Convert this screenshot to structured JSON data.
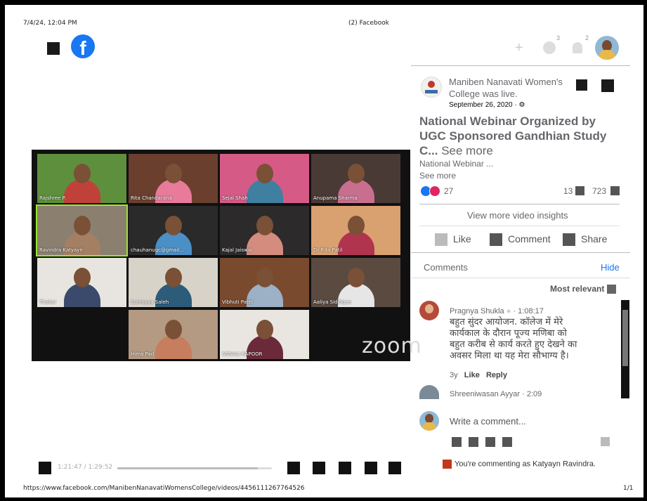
{
  "print_header": {
    "datetime": "7/4/24, 12:04 PM",
    "page_title": "(2) Facebook"
  },
  "print_footer": {
    "url": "https://www.facebook.com/ManibenNanavatiWomensCollege/videos/4456111267764526",
    "page_num": "1/1"
  },
  "nav": {
    "logo": "f",
    "messenger_count": "3",
    "notif_count": "2",
    "plus": "+"
  },
  "video": {
    "participants": [
      {
        "name": "Rajshree P.",
        "bg": "#5e8f3c",
        "shirt": "#c0413a"
      },
      {
        "name": "Rita Chandarana",
        "bg": "#6b3f2e",
        "shirt": "#e87a9a"
      },
      {
        "name": "Sejal Shah",
        "bg": "#d65a86",
        "shirt": "#3f7fa0"
      },
      {
        "name": "Anupama Sharma",
        "bg": "#4a3a35",
        "shirt": "#c86f90"
      },
      {
        "name": "Ravindra Katyayn",
        "bg": "#8b8070",
        "shirt": "#a57f63"
      },
      {
        "name": "chauhanugc@gmail...",
        "bg": "#2a2a2a",
        "shirt": "#4a8fc6"
      },
      {
        "name": "Kajal Jaiswal",
        "bg": "#2c2a2a",
        "shirt": "#d48c7f"
      },
      {
        "name": "Dr Rita Patil",
        "bg": "#d9a070",
        "shirt": "#b1344f"
      },
      {
        "name": "Thakar",
        "bg": "#e8e5e0",
        "shirt": "#3b4a6b"
      },
      {
        "name": "Sumayya Saleh",
        "bg": "#d8d3c9",
        "shirt": "#2d5b7a"
      },
      {
        "name": "Vibhuti Patel",
        "bg": "#7a4a2e",
        "shirt": "#9cb0c6"
      },
      {
        "name": "Aaliya Siddique",
        "bg": "#5a4a40",
        "shirt": "#e6e6e6"
      },
      {
        "name": "Hima Pad",
        "bg": "#b49a82",
        "shirt": "#c77e5e"
      },
      {
        "name": "SONALI KAPOOR",
        "bg": "#e9e6e2",
        "shirt": "#6b2a3a"
      }
    ],
    "zoom_label": "zoom",
    "time": "1:21:47 / 1:29:52"
  },
  "post": {
    "page_name": "Maniben Nanavati Women's",
    "page_name2": "College",
    "action": " was live.",
    "date": "September 26, 2020 · ⚙",
    "title_line1": "National Webinar Organized by",
    "title_line2": "UGC Sponsored Gandhian Study",
    "title_line3": "C...",
    "see_more_1": "See more",
    "desc": "National Webinar ...",
    "see_more_2": "See more",
    "reactions": "27",
    "comments_count": "13",
    "views_count": "723",
    "insights": "View more video insights",
    "like": "Like",
    "comment": "Comment",
    "share": "Share"
  },
  "comments": {
    "header": "Comments",
    "hide": "Hide",
    "sort": "Most relevant",
    "c1_author": "Pragnya Shukla",
    "c1_time": "· 1:08:17",
    "c1_lines": [
      "बहुत सुंदर आयोजन. कॉलेज में मेरे",
      "कार्यकाल के दौरान पूज्य मणिबा को",
      "बहुत करीब से कार्य करते हुए देखने का",
      "अवसर मिला था यह मेरा सौभाग्य है।"
    ],
    "c1_age": "3y",
    "c1_like": "Like",
    "c1_reply": "Reply",
    "c2_author": "Shreeniwasan Ayyar",
    "c2_time": "· 2:09",
    "write_placeholder": "Write a comment...",
    "commenting_as": "You're commenting as Katyayn Ravindra."
  },
  "colors": {
    "fb_blue": "#1877f2",
    "accent_link": "#1877f2",
    "active_speaker": "#9ae62e"
  }
}
